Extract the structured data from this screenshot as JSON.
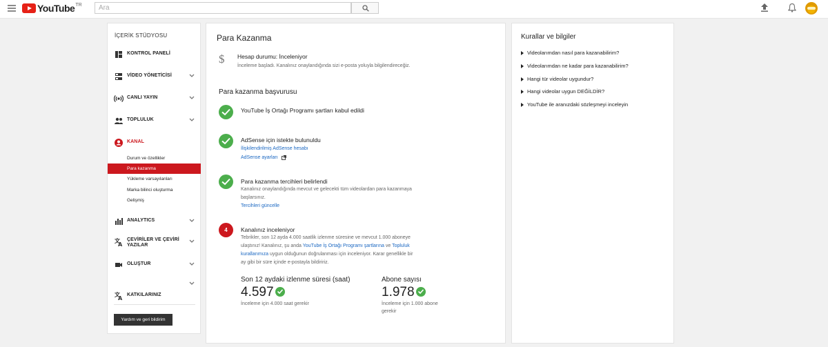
{
  "topbar": {
    "logo_text": "YouTube",
    "logo_region": "TR",
    "search_placeholder": "Ara"
  },
  "sidebar": {
    "studio_title": "İÇERİK STÜDYOSU",
    "items": [
      {
        "label": "KONTROL PANELİ",
        "icon": "dashboard-icon"
      },
      {
        "label": "VİDEO YÖNETİCİSİ",
        "icon": "video-manager-icon"
      },
      {
        "label": "CANLI YAYIN",
        "icon": "live-icon"
      },
      {
        "label": "TOPLULUK",
        "icon": "community-icon"
      },
      {
        "label": "KANAL",
        "icon": "channel-icon"
      },
      {
        "label": "ANALYTICS",
        "icon": "analytics-icon"
      },
      {
        "label": "ÇEVİRİLER VE ÇEVİRİ\nYAZILAR",
        "icon": "translate-icon"
      },
      {
        "label": "OLUŞTUR",
        "icon": "create-icon"
      },
      {
        "label": "KATKILARINIZ",
        "icon": "contributions-icon"
      }
    ],
    "channel_subitems": [
      "Durum ve özellikler",
      "Para kazanma",
      "Yükleme varsayılanları",
      "Marka bilinci oluşturma",
      "Gelişmiş"
    ],
    "feedback_button": "Yardım ve geri bildirim"
  },
  "main": {
    "title": "Para Kazanma",
    "account_status": "Hesap durumu: İnceleniyor",
    "account_desc": "İnceleme başladı. Kanalınız onaylandığında sizi e-posta yoluyla bilgilendireceğiz.",
    "application_title": "Para kazanma başvurusu",
    "step1_title": "YouTube İş Ortağı Programı şartları kabul edildi",
    "step2_title": "AdSense için istekte bulunuldu",
    "step2_link1": "İlişkilendirilmiş AdSense hesabı",
    "step2_link2": "AdSense ayarları",
    "step3_title": "Para kazanma tercihleri belirlendi",
    "step3_text_line1": "Kanalınız onaylandığında mevcut ve gelecekti tüm videolardan para kazanmaya",
    "step3_text_line2": "başlarsınız.",
    "step3_link": "Tercihleri güncelle",
    "step4_number": "4",
    "step4_title": "Kanalınız inceleniyor",
    "step4_line1": "Tebrikler, son 12 ayda 4.000 saatlik izlenme süresine ve mevcut 1.000 aboneye",
    "step4_line2_a": "ulaştınız! Kanalınız, şu anda ",
    "step4_line2_link1": "YouTube İş Ortağı Programı şartlarına",
    "step4_line2_b": " ve ",
    "step4_line2_link2": "Topluluk",
    "step4_line3_link": "kurallarımıza",
    "step4_line3_b": " uygun olduğunun doğrulanması için inceleniyor. Karar genellikle bir",
    "step4_line4": "ay gibi bir süre içinde e-postayla bildiririz.",
    "stats": [
      {
        "title": "Son 12 aydaki izlenme süresi (saat)",
        "value": "4.597",
        "note_line1": "İnceleme için 4.000 saat gerekir",
        "note_line2": ""
      },
      {
        "title": "Abone sayısı",
        "value": "1.978",
        "note_line1": "İnceleme için 1.000 abone",
        "note_line2": "gerekir"
      }
    ]
  },
  "rules": {
    "title": "Kurallar ve bilgiler",
    "items": [
      "Videolarımdan nasıl para kazanabilirim?",
      "Videolarımdan ne kadar para kazanabilirim?",
      "Hangi tür videolar uygundur?",
      "Hangi videolar uygun DEĞİLDİR?",
      "YouTube ile aranızdaki sözleşmeyi inceleyin"
    ]
  },
  "colors": {
    "brand_red": "#cc181e",
    "check_green": "#4cae4c",
    "link_blue": "#1a67c2"
  }
}
